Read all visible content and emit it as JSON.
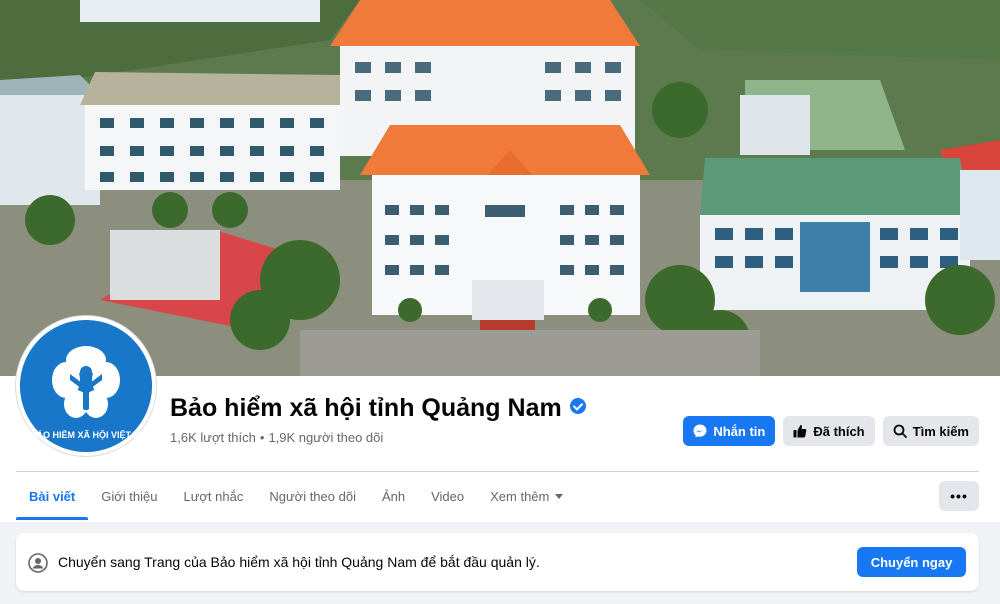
{
  "page": {
    "name": "Bảo hiểm xã hội tỉnh Quảng Nam",
    "likes": "1,6K lượt thích",
    "separator": "•",
    "followers": "1,9K người theo dõi"
  },
  "avatar": {
    "logo_text": "BẢO HIỂM XÃ HỘI VIỆT NAM"
  },
  "actions": {
    "message_label": "Nhắn tin",
    "liked_label": "Đã thích",
    "search_label": "Tìm kiếm"
  },
  "tabs": [
    {
      "label": "Bài viết",
      "active": true
    },
    {
      "label": "Giới thiệu"
    },
    {
      "label": "Lượt nhắc"
    },
    {
      "label": "Người theo dõi"
    },
    {
      "label": "Ảnh"
    },
    {
      "label": "Video"
    },
    {
      "label": "Xem thêm"
    }
  ],
  "more_button": "•••",
  "notice": {
    "text": "Chuyển sang Trang của Bảo hiểm xã hội tỉnh Quảng Nam để bắt đầu quản lý.",
    "button_label": "Chuyển ngay"
  },
  "colors": {
    "accent": "#1877f2",
    "logo_blue": "#1877c9",
    "roof_orange": "#e8642c",
    "roof_green": "#5a9a7a"
  },
  "icons": {
    "message": "messenger-icon",
    "liked": "thumbs-up-icon",
    "search": "search-icon",
    "notice": "profile-switch-icon",
    "verified": "verified-badge-icon"
  }
}
